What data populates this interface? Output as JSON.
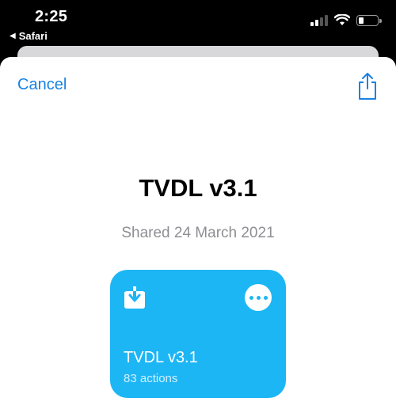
{
  "status_bar": {
    "time": "2:25",
    "back_app": "Safari",
    "back_caret": "◀",
    "signal_bars_active": 2,
    "signal_bars_total": 4,
    "battery_level_fraction": 0.25,
    "icons": [
      "signal-icon",
      "wifi-icon",
      "battery-icon"
    ]
  },
  "header": {
    "cancel_label": "Cancel",
    "share_icon": "share-icon"
  },
  "shortcut": {
    "title": "TVDL v3.1",
    "shared_text": "Shared 24 March 2021",
    "tile": {
      "name": "TVDL v3.1",
      "actions_text": "83 actions",
      "icon": "download-icon",
      "more_icon": "ellipsis-icon",
      "color": "#1db6f5"
    }
  },
  "colors": {
    "accent": "#1a82e2",
    "tile": "#1db6f5",
    "subtitle": "#8e8e93"
  }
}
